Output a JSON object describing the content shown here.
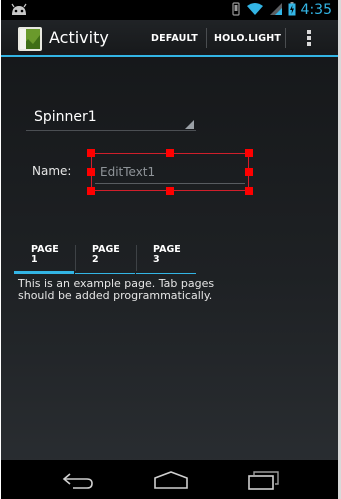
{
  "status_bar": {
    "time": "4:35",
    "icons": [
      "android-debug-icon",
      "vibrate-icon",
      "wifi-icon",
      "signal-icon",
      "battery-icon"
    ]
  },
  "action_bar": {
    "title": "Activity",
    "buttons": [
      "DEFAULT",
      "HOLO.LIGHT"
    ],
    "overflow_icon": "overflow-menu-icon"
  },
  "form": {
    "spinner_value": "Spinner1",
    "name_label": "Name:",
    "edit_placeholder": "EditText1"
  },
  "tabs": {
    "items": [
      {
        "label": "PAGE\n1"
      },
      {
        "label": "PAGE\n2"
      },
      {
        "label": "PAGE\n3"
      }
    ],
    "selected_index": 0,
    "body": "This is an example page. Tab pages should be added programmatically."
  },
  "nav_bar": {
    "icons": [
      "back-icon",
      "home-icon",
      "recents-icon"
    ]
  },
  "colors": {
    "accent": "#33b5e5",
    "selection": "#ff0000"
  }
}
